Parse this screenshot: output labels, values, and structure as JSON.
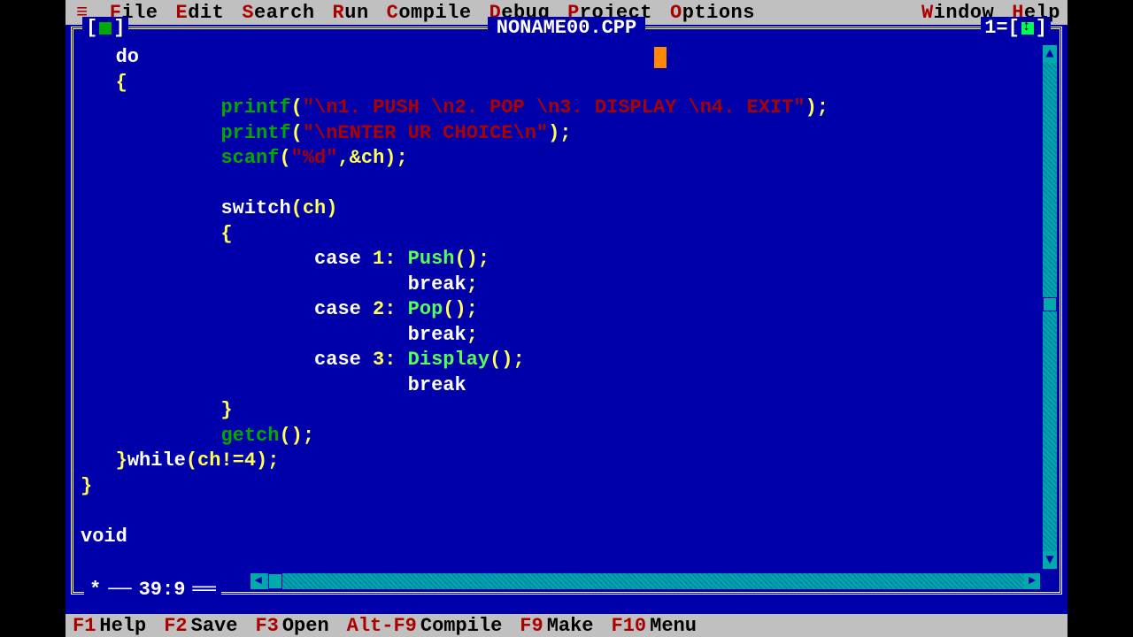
{
  "menu": {
    "sys": "≡",
    "items": [
      {
        "hot": "F",
        "rest": "ile"
      },
      {
        "hot": "E",
        "rest": "dit"
      },
      {
        "hot": "S",
        "rest": "earch"
      },
      {
        "hot": "R",
        "rest": "un"
      },
      {
        "hot": "C",
        "rest": "ompile"
      },
      {
        "hot": "D",
        "rest": "ebug"
      },
      {
        "hot": "P",
        "rest": "roject"
      },
      {
        "hot": "O",
        "rest": "ptions"
      }
    ],
    "right": [
      {
        "hot": "W",
        "rest": "indow"
      },
      {
        "hot": "H",
        "rest": "elp"
      }
    ]
  },
  "window": {
    "close_l": "[",
    "close_r": "]",
    "title": "NONAME00.CPP",
    "number": "1",
    "max_l": "=[",
    "max_r": "]"
  },
  "status": {
    "star": "*",
    "dashes": "──",
    "pos": "39:9",
    "dashes2": "══"
  },
  "code": {
    "l1a": "   do",
    "l2a": "   {",
    "l3a": "            ",
    "l3fn": "printf",
    "l3b": "(",
    "l3str": "\"\\n1. PUSH \\n2. POP \\n3. DISPLAY \\n4. EXIT\"",
    "l3c": ");",
    "l4a": "            ",
    "l4fn": "printf",
    "l4b": "(",
    "l4str": "\"\\nENTER UR CHOICE\\n\"",
    "l4c": ");",
    "l5a": "            ",
    "l5fn": "scanf",
    "l5b": "(",
    "l5str": "\"%d\"",
    "l5c": ",&ch);",
    "l6": "",
    "l7a": "            ",
    "l7kw": "switch",
    "l7b": "(ch)",
    "l8a": "            {",
    "l9a": "                    ",
    "l9kw": "case",
    "l9b": " 1: ",
    "l9sp": "Push",
    "l9c": "();",
    "l10a": "                            ",
    "l10kw": "break",
    "l10b": ";",
    "l11a": "                    ",
    "l11kw": "case",
    "l11b": " 2: ",
    "l11sp": "Pop",
    "l11c": "();",
    "l12a": "                            ",
    "l12kw": "break",
    "l12b": ";",
    "l13a": "                    ",
    "l13kw": "case",
    "l13b": " 3: ",
    "l13sp": "Display",
    "l13c": "();",
    "l14a": "                            ",
    "l14kw": "break",
    "l15a": "            }",
    "l16a": "            ",
    "l16fn": "getch",
    "l16b": "();",
    "l17a": "   }",
    "l17kw": "while",
    "l17b": "(ch!=4);",
    "l18a": "}",
    "l19": "",
    "l20kw": "void"
  },
  "fkeys": [
    {
      "key": "F1",
      "label": "Help"
    },
    {
      "key": "F2",
      "label": "Save"
    },
    {
      "key": "F3",
      "label": "Open"
    },
    {
      "key": "Alt-F9",
      "label": "Compile"
    },
    {
      "key": "F9",
      "label": "Make"
    },
    {
      "key": "F10",
      "label": "Menu"
    }
  ],
  "arrows": {
    "up": "▲",
    "down": "▼",
    "left": "◄",
    "right": "►"
  }
}
